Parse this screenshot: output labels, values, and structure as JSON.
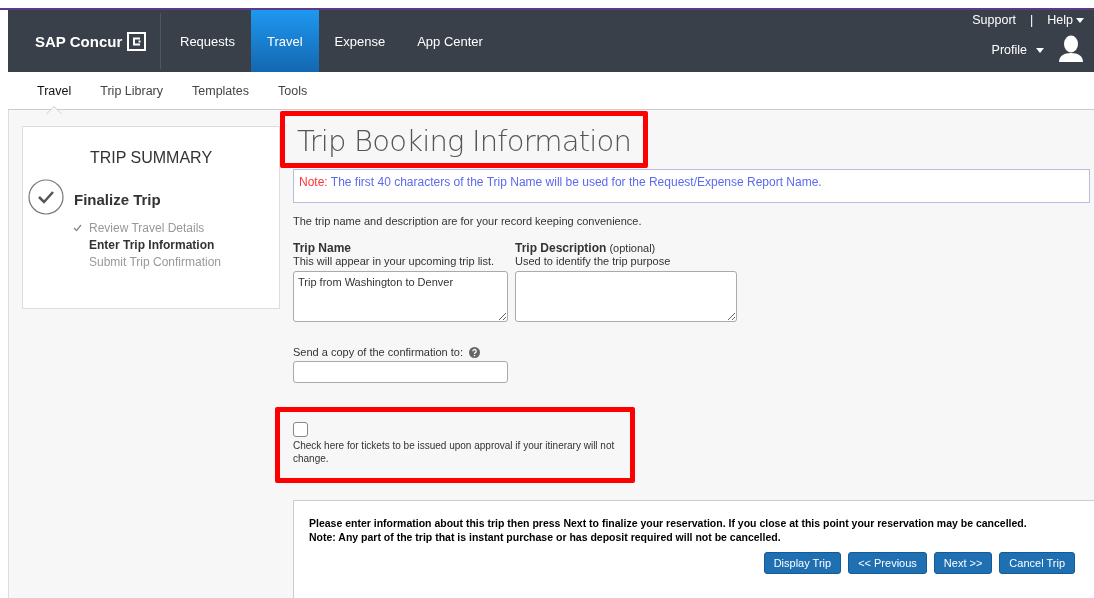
{
  "header": {
    "logo": "SAP Concur",
    "tabs": [
      {
        "label": "Requests",
        "selected": false
      },
      {
        "label": "Travel",
        "selected": true
      },
      {
        "label": "Expense",
        "selected": false
      },
      {
        "label": "App Center",
        "selected": false
      }
    ],
    "support": "Support",
    "separator": "|",
    "help": "Help",
    "profile": "Profile"
  },
  "subnav": [
    {
      "label": "Travel",
      "selected": true
    },
    {
      "label": "Trip Library",
      "selected": false
    },
    {
      "label": "Templates",
      "selected": false
    },
    {
      "label": "Tools",
      "selected": false
    }
  ],
  "summary": {
    "title": "TRIP SUMMARY",
    "step": "Finalize Trip",
    "items": [
      {
        "label": "Review Travel Details",
        "done": true,
        "current": false
      },
      {
        "label": "Enter Trip Information",
        "done": false,
        "current": true
      },
      {
        "label": "Submit Trip Confirmation",
        "done": false,
        "current": false
      }
    ]
  },
  "form": {
    "title": "Trip Booking Information",
    "title_highlighted": true,
    "note_label": "Note:",
    "note": "The first 40 characters of the Trip Name will be used for the Request/Expense Report Name.",
    "intro": "The trip name and description are for your record keeping convenience.",
    "fields": [
      {
        "label": "Trip Name",
        "hint": "This will appear in your upcoming trip list.",
        "value": "Trip from Washington to Denver"
      },
      {
        "label": "Trip Description",
        "optional": "(optional)",
        "hint": "Used to identify the trip purpose"
      }
    ],
    "copy_label": "Send a copy of the confirmation to:",
    "ticket": {
      "checked": false,
      "highlighted": true,
      "label": "Check here for tickets to be issued upon approval if your itinerary will not change."
    },
    "message": [
      "Please enter information about this trip then press Next to finalize your reservation. If you close at this point your reservation may be cancelled.",
      "Note: Any part of the trip that is instant purchase or has deposit required will not be cancelled."
    ],
    "buttons": [
      "Display Trip",
      "<< Previous",
      "Next >>",
      "Cancel Trip"
    ]
  }
}
